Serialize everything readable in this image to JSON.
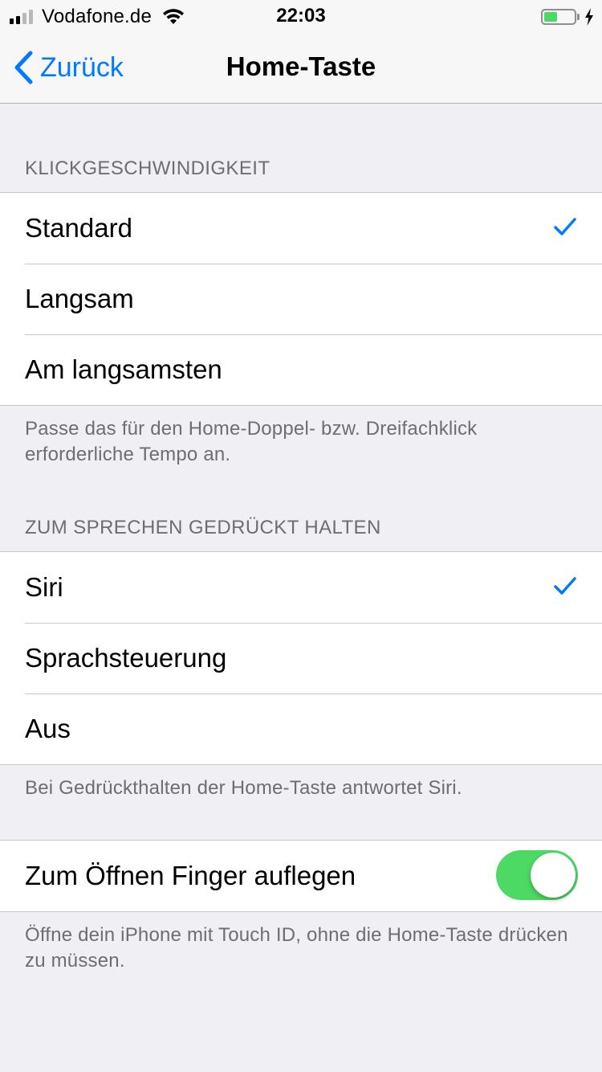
{
  "status_bar": {
    "carrier": "Vodafone.de",
    "time": "22:03",
    "battery_level": 0.45
  },
  "nav": {
    "back_label": "Zurück",
    "title": "Home-Taste"
  },
  "click_speed": {
    "header": "KLICKGESCHWINDIGKEIT",
    "options": [
      {
        "label": "Standard",
        "selected": true
      },
      {
        "label": "Langsam",
        "selected": false
      },
      {
        "label": "Am langsamsten",
        "selected": false
      }
    ],
    "footer": "Passe das für den Home-Doppel- bzw. Dreifachklick erforderliche Tempo an."
  },
  "press_and_hold": {
    "header": "ZUM SPRECHEN GEDRÜCKT HALTEN",
    "options": [
      {
        "label": "Siri",
        "selected": true
      },
      {
        "label": "Sprachsteuerung",
        "selected": false
      },
      {
        "label": "Aus",
        "selected": false
      }
    ],
    "footer": "Bei Gedrückthalten der Home-Taste antwortet Siri."
  },
  "rest_finger": {
    "label": "Zum Öffnen Finger auflegen",
    "enabled": true,
    "footer": "Öffne dein iPhone mit Touch ID, ohne die Home-Taste drücken zu müssen."
  },
  "colors": {
    "accent": "#007aff",
    "toggle_on": "#4cd964",
    "background": "#efeff4",
    "secondary_text": "#6d6d72"
  }
}
